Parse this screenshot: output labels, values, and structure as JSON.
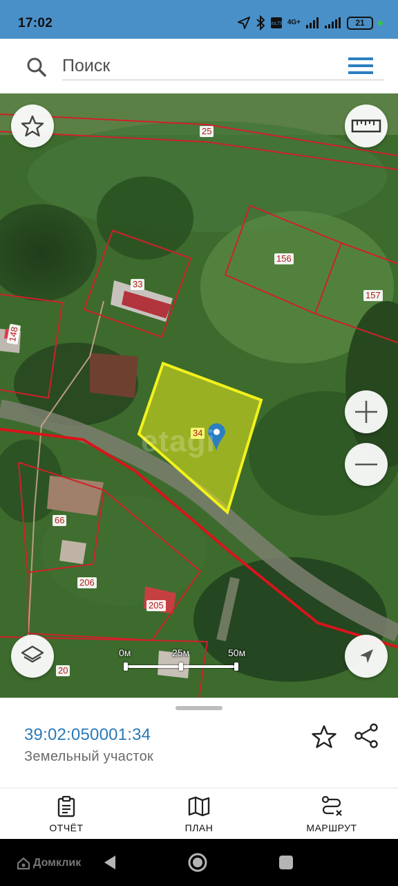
{
  "status_bar": {
    "time": "17:02",
    "network": "4G+",
    "battery": "21",
    "icons": [
      "location-arrow-icon",
      "bluetooth-icon",
      "volte-icon",
      "signal-icon",
      "signal-icon",
      "battery-icon"
    ]
  },
  "search": {
    "placeholder": "Поиск",
    "icon": "search-icon",
    "menu_icon": "hamburger-menu-icon"
  },
  "map": {
    "watermark": "etagi",
    "parcel_labels": [
      "25",
      "156",
      "157",
      "33",
      "148",
      "34",
      "66",
      "206",
      "205",
      "20"
    ],
    "selected_parcel": "34",
    "selection_color": "#e8ea1c",
    "boundary_color": "#d0202a",
    "scale": {
      "labels": [
        "0м",
        "25м",
        "50м"
      ]
    },
    "controls": [
      "favorite-star-icon",
      "ruler-icon",
      "zoom-in-icon",
      "zoom-out-icon",
      "layers-icon",
      "my-location-icon"
    ]
  },
  "sheet": {
    "cadastral_number": "39:02:050001:34",
    "object_type": "Земельный участок"
  },
  "actions": [
    {
      "label": "ОТЧЁТ",
      "icon": "clipboard-report-icon"
    },
    {
      "label": "ПЛАН",
      "icon": "map-plan-icon"
    },
    {
      "label": "МАРШРУТ",
      "icon": "route-icon"
    }
  ],
  "nav_bar": {
    "brand": "Домклик",
    "icons": [
      "back-icon",
      "home-icon",
      "recents-icon"
    ]
  }
}
